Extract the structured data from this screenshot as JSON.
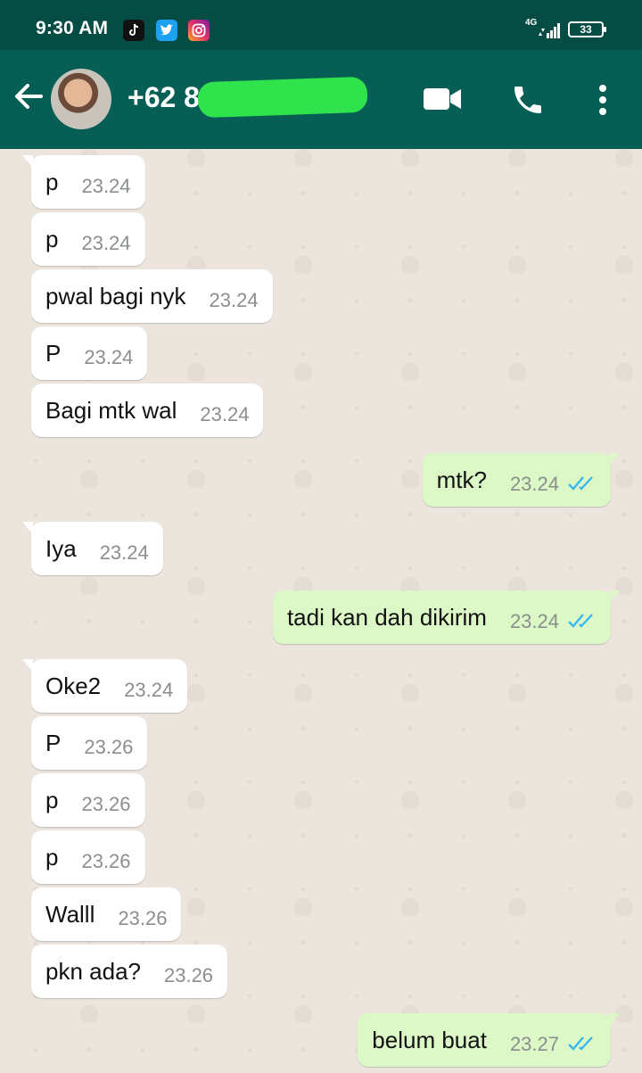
{
  "status_bar": {
    "time": "9:30 AM",
    "network": "4G",
    "battery": "33",
    "icons": [
      "tiktok-icon",
      "twitter-icon",
      "instagram-icon",
      "signal-icon",
      "battery-icon"
    ]
  },
  "header": {
    "contact": "+62 8",
    "icons": [
      "back-arrow-icon",
      "video-call-icon",
      "voice-call-icon",
      "more-options-icon"
    ]
  },
  "colors": {
    "header": "#075e54",
    "status_bar": "#054d44",
    "outgoing_bubble": "#dcf8c6",
    "incoming_bubble": "#ffffff",
    "read_ticks": "#34b7f1"
  },
  "messages": [
    {
      "dir": "in",
      "text": "p",
      "time": "23.24"
    },
    {
      "dir": "in",
      "text": "p",
      "time": "23.24"
    },
    {
      "dir": "in",
      "text": "pwal bagi nyk",
      "time": "23.24"
    },
    {
      "dir": "in",
      "text": "P",
      "time": "23.24"
    },
    {
      "dir": "in",
      "text": "Bagi mtk wal",
      "time": "23.24"
    },
    {
      "dir": "out",
      "text": "mtk?",
      "time": "23.24",
      "read": true
    },
    {
      "dir": "in",
      "text": "Iya",
      "time": "23.24"
    },
    {
      "dir": "out",
      "text": "tadi kan dah dikirim",
      "time": "23.24",
      "read": true
    },
    {
      "dir": "in",
      "text": "Oke2",
      "time": "23.24"
    },
    {
      "dir": "in",
      "text": "P",
      "time": "23.26"
    },
    {
      "dir": "in",
      "text": "p",
      "time": "23.26"
    },
    {
      "dir": "in",
      "text": "p",
      "time": "23.26"
    },
    {
      "dir": "in",
      "text": "Walll",
      "time": "23.26"
    },
    {
      "dir": "in",
      "text": "pkn ada?",
      "time": "23.26"
    },
    {
      "dir": "out",
      "text": "belum buat",
      "time": "23.27",
      "read": true
    }
  ]
}
